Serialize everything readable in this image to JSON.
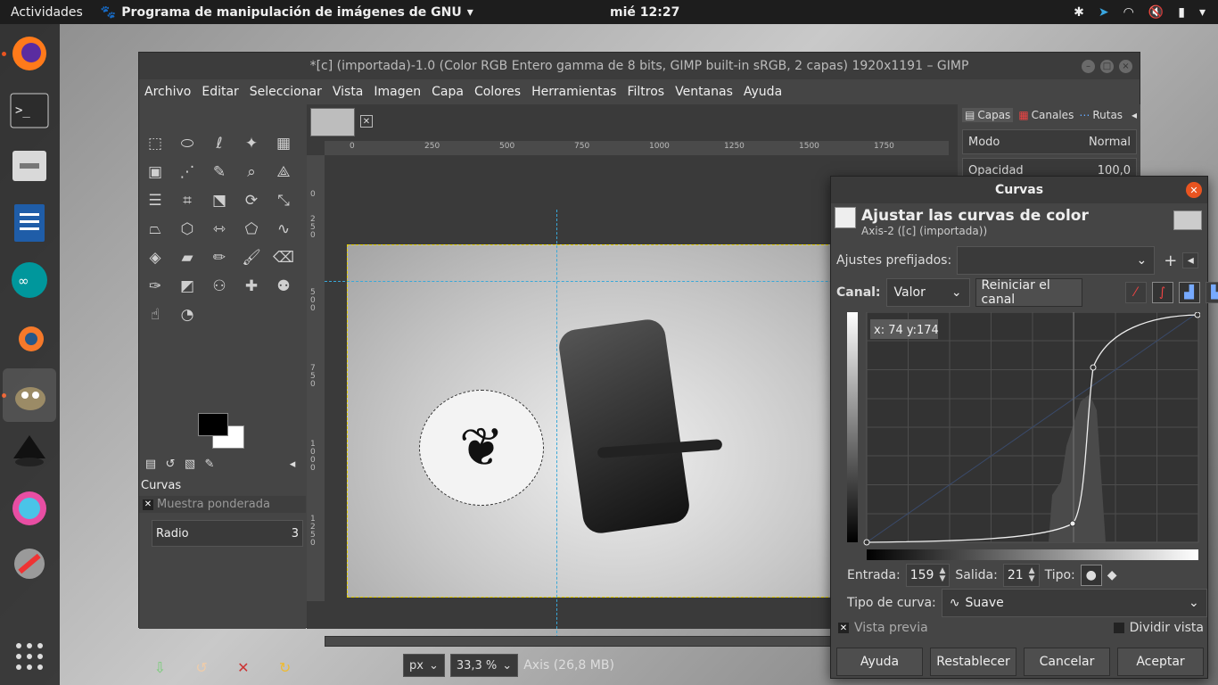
{
  "topbar": {
    "activities": "Actividades",
    "app_name": "Programa de manipulación de imágenes de GNU",
    "clock": "mié 12:27"
  },
  "dock": {
    "items": [
      "firefox-icon",
      "terminal-icon",
      "files-icon",
      "libreoffice-writer-icon",
      "arduino-icon",
      "blender-icon",
      "gimp-icon",
      "inkscape-icon",
      "krita-icon",
      "settings-icon",
      "app-grid-icon"
    ]
  },
  "gimp": {
    "title": "*[c] (importada)-1.0 (Color RGB Entero gamma de 8 bits, GIMP built-in sRGB, 2 capas) 1920x1191 – GIMP",
    "menu": [
      "Archivo",
      "Editar",
      "Seleccionar",
      "Vista",
      "Imagen",
      "Capa",
      "Colores",
      "Herramientas",
      "Filtros",
      "Ventanas",
      "Ayuda"
    ],
    "tool_options": {
      "title": "Curvas",
      "sample_merged": "Muestra ponderada",
      "radius_label": "Radio",
      "radius_value": "3"
    },
    "ruler_h": [
      "0",
      "250",
      "500",
      "750",
      "1000",
      "1250",
      "1500",
      "1750"
    ],
    "ruler_v": [
      "0",
      "250",
      "500",
      "750",
      "1000",
      "1250"
    ],
    "status": {
      "unit": "px",
      "zoom": "33,3 %",
      "info": "Axis (26,8 MB)"
    },
    "layers_panel": {
      "tabs": [
        "Capas",
        "Canales",
        "Rutas"
      ],
      "mode_label": "Modo",
      "mode_value": "Normal",
      "opacity_label": "Opacidad",
      "opacity_value": "100,0"
    }
  },
  "curves": {
    "dialog_title": "Curvas",
    "heading": "Ajustar las curvas de color",
    "subheading": "Axis-2 ([c] (importada))",
    "presets_label": "Ajustes prefijados:",
    "presets_value": "",
    "channel_label": "Canal:",
    "channel_value": "Valor",
    "reset_channel": "Reiniciar el canal",
    "cursor_readout": "x: 74 y:174",
    "input_label": "Entrada:",
    "input_value": "159",
    "output_label": "Salida:",
    "output_value": "21",
    "type_label": "Tipo:",
    "curve_type_label": "Tipo de curva:",
    "curve_type_value": "Suave",
    "preview_label": "Vista previa",
    "split_label": "Dividir vista",
    "buttons": {
      "help": "Ayuda",
      "reset": "Restablecer",
      "cancel": "Cancelar",
      "ok": "Aceptar"
    }
  }
}
